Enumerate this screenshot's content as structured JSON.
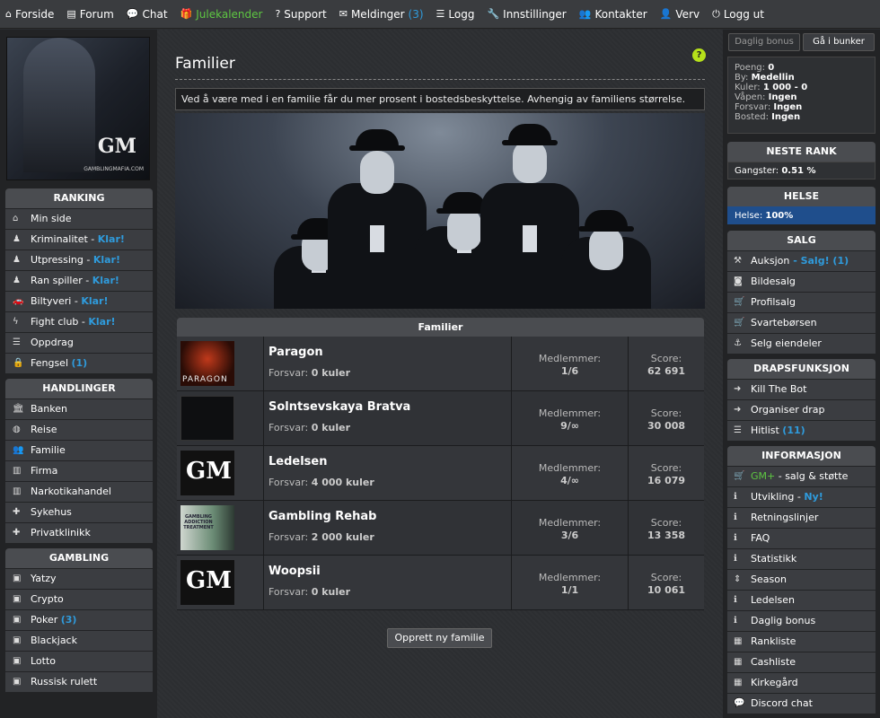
{
  "topnav": [
    {
      "label": "Forside",
      "icon": "home-icon",
      "glyph": "⌂"
    },
    {
      "label": "Forum",
      "icon": "forum-icon",
      "glyph": "▤"
    },
    {
      "label": "Chat",
      "icon": "chat-icon",
      "glyph": "💬"
    },
    {
      "label": "Julekalender",
      "icon": "gift-icon",
      "glyph": "🎁"
    },
    {
      "label": "Support",
      "icon": "question-icon",
      "glyph": "?"
    },
    {
      "label": "Meldinger",
      "icon": "envelope-icon",
      "glyph": "✉",
      "badge": "(3)"
    },
    {
      "label": "Logg",
      "icon": "list-icon",
      "glyph": "☰"
    },
    {
      "label": "Innstillinger",
      "icon": "wrench-icon",
      "glyph": "🔧"
    },
    {
      "label": "Kontakter",
      "icon": "users-icon",
      "glyph": "👥"
    },
    {
      "label": "Verv",
      "icon": "user-plus-icon",
      "glyph": "👤"
    },
    {
      "label": "Logg ut",
      "icon": "logout-icon",
      "glyph": "⏻"
    }
  ],
  "logo": {
    "letters": "GM",
    "site": "GAMBLINGMAFIA.COM"
  },
  "left": {
    "ranking": {
      "title": "RANKING",
      "items": [
        {
          "label": "Min side",
          "icon": "home-icon",
          "glyph": "⌂",
          "extra": ""
        },
        {
          "label": "Kriminalitet - ",
          "icon": "person-icon",
          "glyph": "♟",
          "extra": "Klar!"
        },
        {
          "label": "Utpressing - ",
          "icon": "person-icon",
          "glyph": "♟",
          "extra": "Klar!"
        },
        {
          "label": "Ran spiller - ",
          "icon": "person-icon",
          "glyph": "♟",
          "extra": "Klar!"
        },
        {
          "label": "Biltyveri - ",
          "icon": "car-icon",
          "glyph": "🚗",
          "extra": "Klar!"
        },
        {
          "label": "Fight club - ",
          "icon": "bolt-icon",
          "glyph": "ϟ",
          "extra": "Klar!"
        },
        {
          "label": "Oppdrag",
          "icon": "list-icon",
          "glyph": "☰",
          "extra": ""
        },
        {
          "label": "Fengsel ",
          "icon": "lock-icon",
          "glyph": "🔒",
          "extra": "(1)"
        }
      ]
    },
    "handlinger": {
      "title": "HANDLINGER",
      "items": [
        {
          "label": "Banken",
          "icon": "bank-icon",
          "glyph": "🏛"
        },
        {
          "label": "Reise",
          "icon": "globe-icon",
          "glyph": "◍"
        },
        {
          "label": "Familie",
          "icon": "users-icon",
          "glyph": "👥"
        },
        {
          "label": "Firma",
          "icon": "building-icon",
          "glyph": "▥"
        },
        {
          "label": "Narkotikahandel",
          "icon": "building-icon",
          "glyph": "▥"
        },
        {
          "label": "Sykehus",
          "icon": "hospital-icon",
          "glyph": "✚"
        },
        {
          "label": "Privatklinikk",
          "icon": "medkit-icon",
          "glyph": "✚"
        }
      ]
    },
    "gambling": {
      "title": "GAMBLING",
      "items": [
        {
          "label": "Yatzy",
          "icon": "money-icon",
          "glyph": "▣",
          "extra": ""
        },
        {
          "label": "Crypto",
          "icon": "money-icon",
          "glyph": "▣",
          "extra": ""
        },
        {
          "label": "Poker ",
          "icon": "money-icon",
          "glyph": "▣",
          "extra": "(3)"
        },
        {
          "label": "Blackjack",
          "icon": "money-icon",
          "glyph": "▣",
          "extra": ""
        },
        {
          "label": "Lotto",
          "icon": "money-icon",
          "glyph": "▣",
          "extra": ""
        },
        {
          "label": "Russisk rulett",
          "icon": "money-icon",
          "glyph": "▣",
          "extra": ""
        }
      ]
    }
  },
  "main": {
    "title": "Familier",
    "help": "?",
    "info": "Ved å være med i en familie får du mer prosent i bostedsbeskyttelse. Avhengig av familiens størrelse.",
    "table_title": "Familier",
    "members_label": "Medlemmer:",
    "score_label": "Score:",
    "forsvar_label": "Forsvar:",
    "families": [
      {
        "name": "Paragon",
        "forsvar": "0 kuler",
        "members": "1/6",
        "score": "62 691",
        "thumb_text": "PARAGON"
      },
      {
        "name": "Solntsevskaya Bratva",
        "forsvar": "0 kuler",
        "members": "9/∞",
        "score": "30 008",
        "thumb_text": ""
      },
      {
        "name": "Ledelsen",
        "forsvar": "4 000 kuler",
        "members": "4/∞",
        "score": "16 079",
        "thumb_text": "GM"
      },
      {
        "name": "Gambling Rehab",
        "forsvar": "2 000 kuler",
        "members": "3/6",
        "score": "13 358",
        "thumb_text": "GAMBLING ADDICTION TREATMENT"
      },
      {
        "name": "Woopsii",
        "forsvar": "0 kuler",
        "members": "1/1",
        "score": "10 061",
        "thumb_text": "GM"
      }
    ],
    "create_button": "Opprett ny familie"
  },
  "right": {
    "daily_bonus": "Daglig bonus",
    "bunker": "Gå i bunker",
    "stats": [
      {
        "k": "Poeng:",
        "v": "0"
      },
      {
        "k": "By:",
        "v": "Medellin"
      },
      {
        "k": "Kuler:",
        "v": "1 000 - 0"
      },
      {
        "k": "Våpen:",
        "v": "Ingen"
      },
      {
        "k": "Forsvar:",
        "v": "Ingen"
      },
      {
        "k": "Bosted:",
        "v": "Ingen"
      }
    ],
    "neste_rank": {
      "title": "NESTE RANK",
      "label": "Gangster:",
      "value": "0.51 %"
    },
    "helse": {
      "title": "HELSE",
      "label": "Helse:",
      "value": "100%"
    },
    "salg": {
      "title": "SALG",
      "items": [
        {
          "label": "Auksjon",
          "icon": "gavel-icon",
          "glyph": "⚒",
          "extra": " - Salg! (1)"
        },
        {
          "label": "Bildesalg",
          "icon": "camera-icon",
          "glyph": "◙",
          "extra": ""
        },
        {
          "label": "Profilsalg",
          "icon": "cart-icon",
          "glyph": "🛒",
          "extra": ""
        },
        {
          "label": "Svartebørsen",
          "icon": "cart-icon",
          "glyph": "🛒",
          "extra": ""
        },
        {
          "label": "Selg eiendeler",
          "icon": "anchor-icon",
          "glyph": "⚓",
          "extra": ""
        }
      ]
    },
    "drap": {
      "title": "DRAPSFUNKSJON",
      "items": [
        {
          "label": "Kill The Bot",
          "icon": "arrow-right-icon",
          "glyph": "➜",
          "extra": ""
        },
        {
          "label": "Organiser drap",
          "icon": "arrow-right-icon",
          "glyph": "➜",
          "extra": ""
        },
        {
          "label": "Hitlist ",
          "icon": "list-icon",
          "glyph": "☰",
          "extra": "(11)"
        }
      ]
    },
    "info": {
      "title": "INFORMASJON",
      "items": [
        {
          "label": "GM+",
          "icon": "cart-icon",
          "glyph": "🛒",
          "extra": " - salg & støtte",
          "green": true
        },
        {
          "label": "Utvikling - ",
          "icon": "info-icon",
          "glyph": "ℹ",
          "extra": "Ny!"
        },
        {
          "label": "Retningslinjer",
          "icon": "info-icon",
          "glyph": "ℹ",
          "extra": ""
        },
        {
          "label": "FAQ",
          "icon": "info-icon",
          "glyph": "ℹ",
          "extra": ""
        },
        {
          "label": "Statistikk",
          "icon": "info-icon",
          "glyph": "ℹ",
          "extra": ""
        },
        {
          "label": "Season",
          "icon": "sort-icon",
          "glyph": "⇕",
          "extra": ""
        },
        {
          "label": "Ledelsen",
          "icon": "info-icon",
          "glyph": "ℹ",
          "extra": ""
        },
        {
          "label": "Daglig bonus",
          "icon": "info-icon",
          "glyph": "ℹ",
          "extra": ""
        },
        {
          "label": "Rankliste",
          "icon": "table-icon",
          "glyph": "▦",
          "extra": ""
        },
        {
          "label": "Cashliste",
          "icon": "table-icon",
          "glyph": "▦",
          "extra": ""
        },
        {
          "label": "Kirkegård",
          "icon": "table-icon",
          "glyph": "▦",
          "extra": ""
        },
        {
          "label": "Discord chat",
          "icon": "chat-icon",
          "glyph": "💬",
          "extra": ""
        }
      ]
    }
  }
}
